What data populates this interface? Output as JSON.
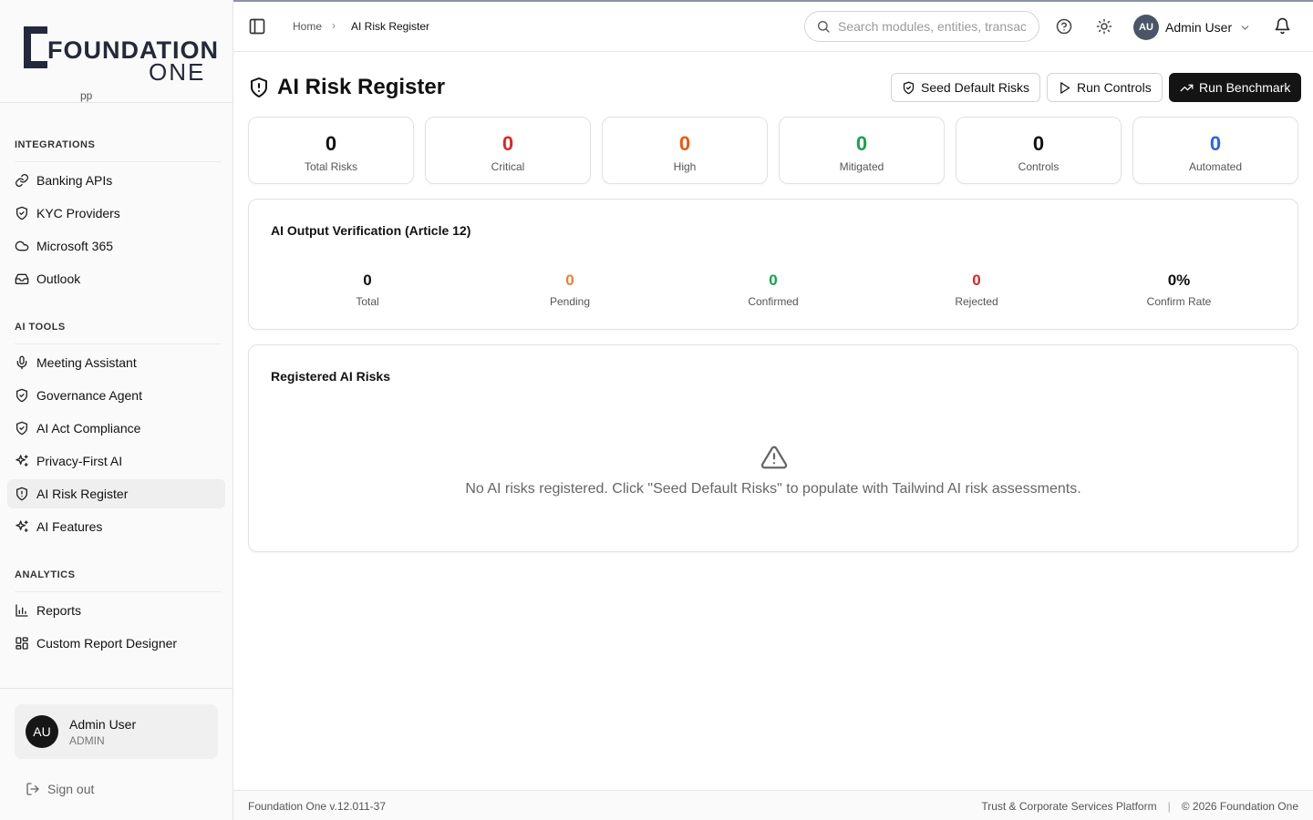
{
  "brand": {
    "logo_main": "FOUNDATION",
    "logo_sub": "ONE",
    "cut_text": "pp"
  },
  "sidebar": {
    "sections": [
      {
        "title": "INTEGRATIONS",
        "items": [
          {
            "label": "Banking APIs",
            "icon": "link-icon"
          },
          {
            "label": "KYC Providers",
            "icon": "shield-check-icon"
          },
          {
            "label": "Microsoft 365",
            "icon": "cloud-icon"
          },
          {
            "label": "Outlook",
            "icon": "inbox-icon"
          }
        ]
      },
      {
        "title": "AI TOOLS",
        "items": [
          {
            "label": "Meeting Assistant",
            "icon": "mic-icon"
          },
          {
            "label": "Governance Agent",
            "icon": "shield-check-icon"
          },
          {
            "label": "AI Act Compliance",
            "icon": "shield-check-icon"
          },
          {
            "label": "Privacy-First AI",
            "icon": "sparkles-icon"
          },
          {
            "label": "AI Risk Register",
            "icon": "shield-alert-icon",
            "active": true
          },
          {
            "label": "AI Features",
            "icon": "sparkles-icon"
          }
        ]
      },
      {
        "title": "ANALYTICS",
        "items": [
          {
            "label": "Reports",
            "icon": "bar-chart-icon"
          },
          {
            "label": "Custom Report Designer",
            "icon": "layout-icon"
          }
        ]
      }
    ],
    "user": {
      "initials": "AU",
      "name": "Admin User",
      "role": "ADMIN"
    },
    "signout_label": "Sign out"
  },
  "header": {
    "breadcrumb": {
      "home": "Home",
      "sep": "›",
      "current": "AI Risk Register"
    },
    "search_placeholder": "Search modules, entities, transactions...",
    "user": {
      "initials": "AU",
      "name": "Admin User"
    }
  },
  "page": {
    "title": "AI Risk Register",
    "actions": {
      "seed": "Seed Default Risks",
      "run_controls": "Run Controls",
      "run_benchmark": "Run Benchmark"
    },
    "stats": [
      {
        "value": "0",
        "label": "Total Risks",
        "color": "#111111"
      },
      {
        "value": "0",
        "label": "Critical",
        "color": "#dc2626"
      },
      {
        "value": "0",
        "label": "High",
        "color": "#ea580c"
      },
      {
        "value": "0",
        "label": "Mitigated",
        "color": "#16a34a"
      },
      {
        "value": "0",
        "label": "Controls",
        "color": "#111111"
      },
      {
        "value": "0",
        "label": "Automated",
        "color": "#2563eb"
      }
    ],
    "verification": {
      "title": "AI Output Verification (Article 12)",
      "stats": [
        {
          "value": "0",
          "label": "Total",
          "color": "#111111"
        },
        {
          "value": "0",
          "label": "Pending",
          "color": "#e8823a"
        },
        {
          "value": "0",
          "label": "Confirmed",
          "color": "#16a34a"
        },
        {
          "value": "0",
          "label": "Rejected",
          "color": "#dc2626"
        },
        {
          "value": "0%",
          "label": "Confirm Rate",
          "color": "#111111"
        }
      ]
    },
    "risks": {
      "title": "Registered AI Risks",
      "empty_message": "No AI risks registered. Click \"Seed Default Risks\" to populate with Tailwind AI risk assessments."
    }
  },
  "footer": {
    "version": "Foundation One v.12.011-37",
    "platform": "Trust & Corporate Services Platform",
    "separator": "|",
    "copyright": "© 2026 Foundation One"
  }
}
